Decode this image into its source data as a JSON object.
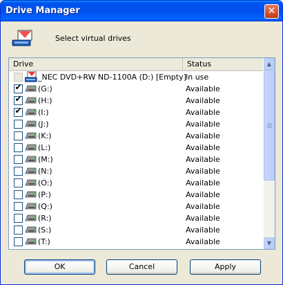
{
  "window": {
    "title": "Drive Manager"
  },
  "header": {
    "text": "Select virtual drives"
  },
  "table": {
    "columns": {
      "drive": "Drive",
      "status": "Status"
    },
    "rows": [
      {
        "label": "_NEC DVD+RW ND-1100A (D:) [Empty]",
        "status": "In use",
        "checked": false,
        "disabled": true,
        "icon": "cd-drive-icon"
      },
      {
        "label": "(G:)",
        "status": "Available",
        "checked": true,
        "disabled": false,
        "icon": "drive-icon"
      },
      {
        "label": "(H:)",
        "status": "Available",
        "checked": true,
        "disabled": false,
        "icon": "drive-icon"
      },
      {
        "label": "(I:)",
        "status": "Available",
        "checked": true,
        "disabled": false,
        "icon": "drive-icon"
      },
      {
        "label": "(J:)",
        "status": "Available",
        "checked": false,
        "disabled": false,
        "icon": "drive-icon"
      },
      {
        "label": "(K:)",
        "status": "Available",
        "checked": false,
        "disabled": false,
        "icon": "drive-icon"
      },
      {
        "label": "(L:)",
        "status": "Available",
        "checked": false,
        "disabled": false,
        "icon": "drive-icon"
      },
      {
        "label": "(M:)",
        "status": "Available",
        "checked": false,
        "disabled": false,
        "icon": "drive-icon"
      },
      {
        "label": "(N:)",
        "status": "Available",
        "checked": false,
        "disabled": false,
        "icon": "drive-icon"
      },
      {
        "label": "(O:)",
        "status": "Available",
        "checked": false,
        "disabled": false,
        "icon": "drive-icon"
      },
      {
        "label": "(P:)",
        "status": "Available",
        "checked": false,
        "disabled": false,
        "icon": "drive-icon"
      },
      {
        "label": "(Q:)",
        "status": "Available",
        "checked": false,
        "disabled": false,
        "icon": "drive-icon"
      },
      {
        "label": "(R:)",
        "status": "Available",
        "checked": false,
        "disabled": false,
        "icon": "drive-icon"
      },
      {
        "label": "(S:)",
        "status": "Available",
        "checked": false,
        "disabled": false,
        "icon": "drive-icon"
      },
      {
        "label": "(T:)",
        "status": "Available",
        "checked": false,
        "disabled": false,
        "icon": "drive-icon"
      }
    ]
  },
  "buttons": {
    "ok": "OK",
    "cancel": "Cancel",
    "apply": "Apply"
  },
  "colors": {
    "titlebar": "#0054e3",
    "dialog_bg": "#ece9d8",
    "close_button": "#c13a12"
  }
}
